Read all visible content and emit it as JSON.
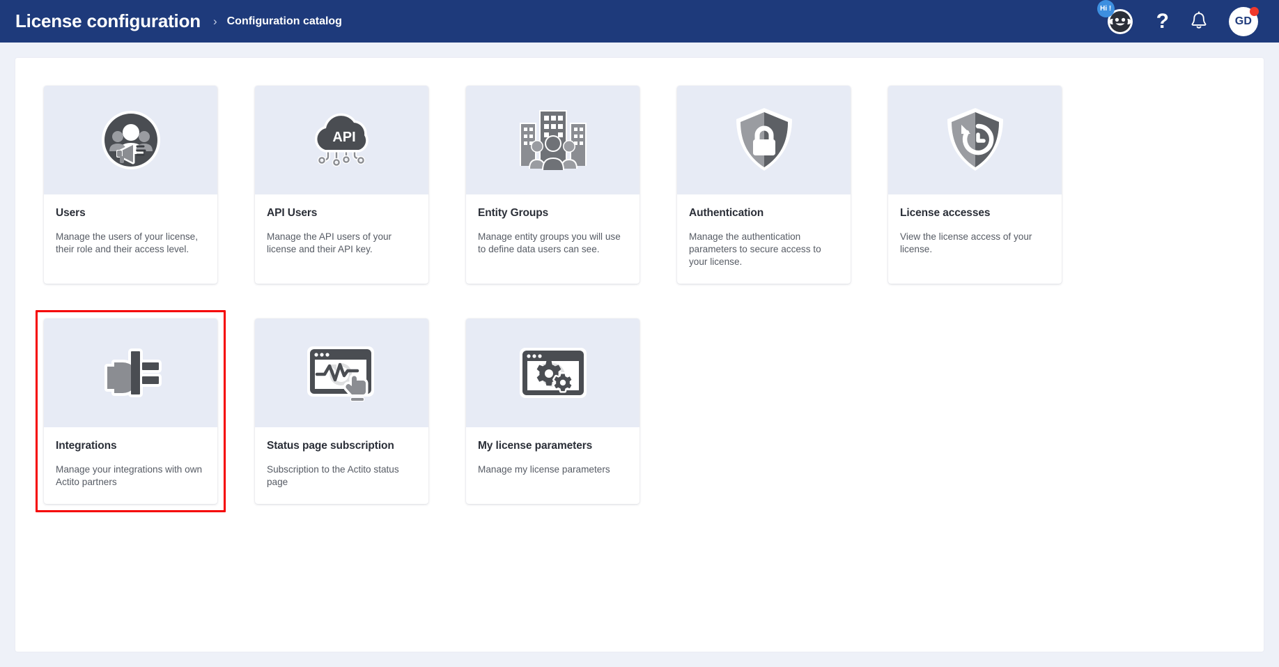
{
  "header": {
    "title": "License configuration",
    "breadcrumb_separator": "›",
    "breadcrumb_current": "Configuration catalog",
    "chatbot_badge": "Hi !",
    "help_label": "?",
    "avatar_initials": "GD",
    "icons": {
      "chatbot": "chatbot-icon",
      "help": "help-icon",
      "notifications": "bell-icon",
      "avatar": "user-avatar"
    },
    "colors": {
      "bar_background": "#1e3a7b",
      "badge_blue": "#3d8fe0",
      "notification_red": "#f0392b"
    }
  },
  "highlight": {
    "color": "#f50000",
    "target": "integrations-card"
  },
  "cards": [
    {
      "id": "users",
      "icon": "users-megaphone-icon",
      "title": "Users",
      "description": "Manage the users of your license, their role and their access level."
    },
    {
      "id": "api-users",
      "icon": "api-cloud-icon",
      "icon_text": "API",
      "title": "API Users",
      "description": "Manage the API users of your license and their API key."
    },
    {
      "id": "entity-groups",
      "icon": "building-people-icon",
      "title": "Entity Groups",
      "description": "Manage entity groups you will use to define data users can see."
    },
    {
      "id": "authentication",
      "icon": "shield-lock-icon",
      "title": "Authentication",
      "description": "Manage the authentication parameters to secure access to your license."
    },
    {
      "id": "license-accesses",
      "icon": "shield-history-icon",
      "title": "License accesses",
      "description": "View the license access of your license."
    },
    {
      "id": "integrations",
      "icon": "plug-icon",
      "title": "Integrations",
      "description": "Manage your integrations with own Actito partners",
      "highlighted": true
    },
    {
      "id": "status-page-subscription",
      "icon": "monitor-pulse-icon",
      "title": "Status page subscription",
      "description": "Subscription to the Actito status page"
    },
    {
      "id": "my-license-parameters",
      "icon": "monitor-gears-icon",
      "title": "My license parameters",
      "description": "Manage my license parameters"
    }
  ]
}
